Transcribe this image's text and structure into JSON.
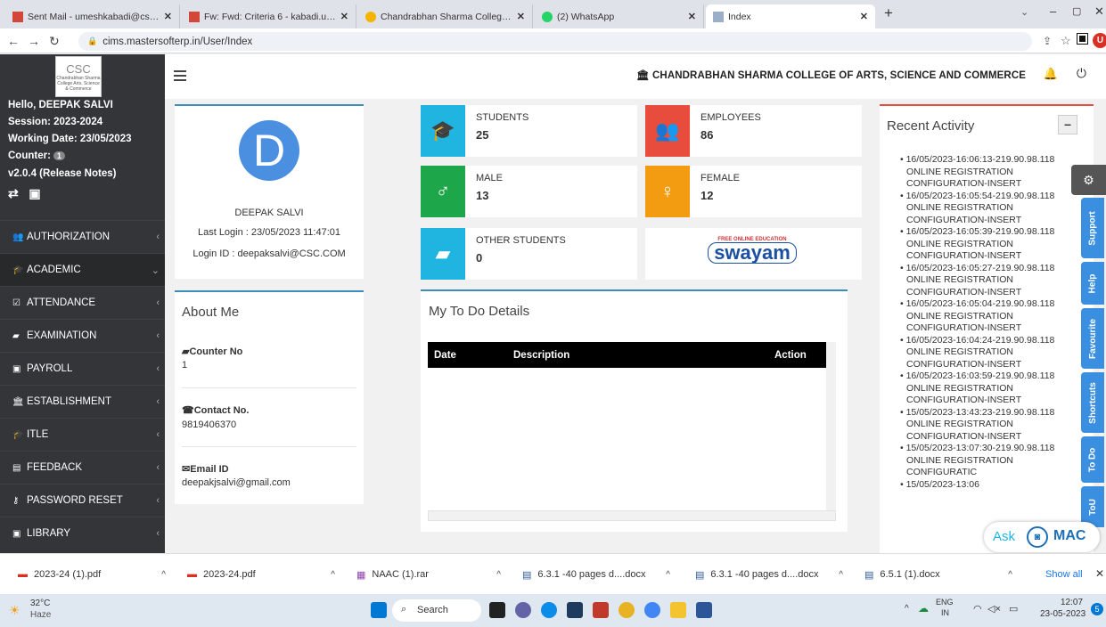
{
  "browser": {
    "tabs": [
      {
        "title": "Sent Mail - umeshkabadi@cscoll",
        "color": "#d44638"
      },
      {
        "title": "Fw: Fwd: Criteria 6 - kabadi.umes",
        "color": "#d44638"
      },
      {
        "title": "Chandrabhan Sharma College – ",
        "color": "#f4b400"
      },
      {
        "title": "(2) WhatsApp",
        "color": "#25d366"
      },
      {
        "title": "Index",
        "color": "#9bb0c8"
      }
    ],
    "url": "cims.mastersofterp.in/User/Index",
    "profile_initial": "U"
  },
  "sidebar": {
    "greeting": "Hello, DEEPAK SALVI",
    "session": "Session: 2023-2024",
    "working_date": "Working Date: 23/05/2023",
    "counter_label": "Counter:",
    "counter_value": "1",
    "version": "v2.0.4 (Release Notes)",
    "logo_text": "CSC",
    "logo_sub": "Chandrabhan Sharma College Arts, Science & Commerce",
    "menu": [
      {
        "label": "AUTHORIZATION",
        "icon": "users-icon"
      },
      {
        "label": "ACADEMIC",
        "icon": "graduation-cap-icon"
      },
      {
        "label": "ATTENDANCE",
        "icon": "check-square-icon"
      },
      {
        "label": "EXAMINATION",
        "icon": "book-icon"
      },
      {
        "label": "PAYROLL",
        "icon": "money-icon"
      },
      {
        "label": "ESTABLISHMENT",
        "icon": "building-icon"
      },
      {
        "label": "ITLE",
        "icon": "graduation-cap-icon"
      },
      {
        "label": "FEEDBACK",
        "icon": "list-icon"
      },
      {
        "label": "PASSWORD RESET",
        "icon": "key-icon"
      },
      {
        "label": "LIBRARY",
        "icon": "library-icon"
      }
    ]
  },
  "header": {
    "college": "CHANDRABHAN SHARMA COLLEGE OF ARTS, SCIENCE AND COMMERCE"
  },
  "profile": {
    "initial": "D",
    "name": "DEEPAK SALVI",
    "last_login": "Last Login : 23/05/2023 11:47:01",
    "login_id": "Login ID : deepaksalvi@CSC.COM"
  },
  "about": {
    "title": "About Me",
    "counter_label": "Counter No",
    "counter_value": "1",
    "contact_label": "Contact No.",
    "contact_value": "9819406370",
    "email_label": "Email ID",
    "email_value": "deepakjsalvi@gmail.com"
  },
  "stats": {
    "students": {
      "label": "STUDENTS",
      "value": "25",
      "color": "#1fb5e0"
    },
    "employees": {
      "label": "EMPLOYEES",
      "value": "86",
      "color": "#e74c3c"
    },
    "male": {
      "label": "MALE",
      "value": "13",
      "color": "#1ea64a"
    },
    "female": {
      "label": "FEMALE",
      "value": "12",
      "color": "#f39c12"
    },
    "other": {
      "label": "OTHER STUDENTS",
      "value": "0",
      "color": "#1fb5e0"
    }
  },
  "swayam": {
    "tag": "FREE ONLINE EDUCATION",
    "name": "swayam"
  },
  "todo": {
    "title": "My To Do Details",
    "cols": [
      "Date",
      "Description",
      "Action"
    ]
  },
  "recent": {
    "title": "Recent Activity",
    "items": [
      "16/05/2023-16:06:13-219.90.98.118 ONLINE REGISTRATION CONFIGURATION-INSERT",
      "16/05/2023-16:05:54-219.90.98.118 ONLINE REGISTRATION CONFIGURATION-INSERT",
      "16/05/2023-16:05:39-219.90.98.118 ONLINE REGISTRATION CONFIGURATION-INSERT",
      "16/05/2023-16:05:27-219.90.98.118 ONLINE REGISTRATION CONFIGURATION-INSERT",
      "16/05/2023-16:05:04-219.90.98.118 ONLINE REGISTRATION CONFIGURATION-INSERT",
      "16/05/2023-16:04:24-219.90.98.118 ONLINE REGISTRATION CONFIGURATION-INSERT",
      "16/05/2023-16:03:59-219.90.98.118 ONLINE REGISTRATION CONFIGURATION-INSERT",
      "15/05/2023-13:43:23-219.90.98.118 ONLINE REGISTRATION CONFIGURATION-INSERT",
      "15/05/2023-13:07:30-219.90.98.118 ONLINE REGISTRATION CONFIGURATIC",
      "15/05/2023-13:06"
    ]
  },
  "side_tabs": [
    "Support",
    "Help",
    "Favourite",
    "Shortcuts",
    "To Do",
    "ToU"
  ],
  "ask_mac": {
    "ask": "Ask",
    "mac": "MAC"
  },
  "downloads": {
    "items": [
      "2023-24 (1).pdf",
      "2023-24.pdf",
      "NAAC (1).rar",
      "6.3.1 -40 pages d....docx",
      "6.3.1 -40 pages d....docx",
      "6.5.1 (1).docx"
    ],
    "show_all": "Show all"
  },
  "taskbar": {
    "weather_temp": "32°C",
    "weather_desc": "Haze",
    "search": "Search",
    "lang": "ENG",
    "region": "IN",
    "time": "12:07",
    "date": "23-05-2023",
    "notif": "5"
  }
}
